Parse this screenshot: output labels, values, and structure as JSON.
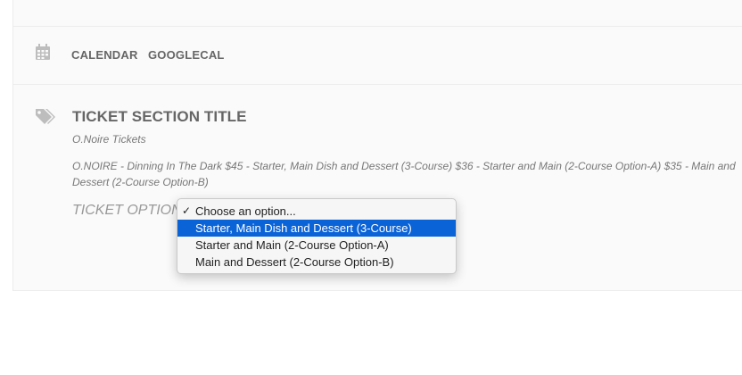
{
  "top": {
    "fragment": "(",
    "fragment_tail": "), . . . . . . . . . ."
  },
  "calendar": {
    "links": [
      "CALENDAR",
      "GOOGLECAL"
    ]
  },
  "ticket_section": {
    "title": "TICKET SECTION TITLE",
    "subtitle": "O.Noire Tickets",
    "description": "O.NOIRE - Dinning In The Dark $45 - Starter, Main Dish and Dessert (3-Course) $36 - Starter and Main (2-Course Option-A) $35 - Main and Dessert (2-Course Option-B)",
    "option_label": "TICKET OPTION"
  },
  "dropdown": {
    "options": [
      "Choose an option...",
      "Starter, Main Dish and Dessert (3-Course)",
      "Starter and Main (2-Course Option-A)",
      "Main and Dessert (2-Course Option-B)"
    ],
    "checked_index": 0,
    "highlighted_index": 1
  },
  "colors": {
    "highlight": "#0b63d8",
    "text_muted": "#777777",
    "heading": "#666666"
  }
}
